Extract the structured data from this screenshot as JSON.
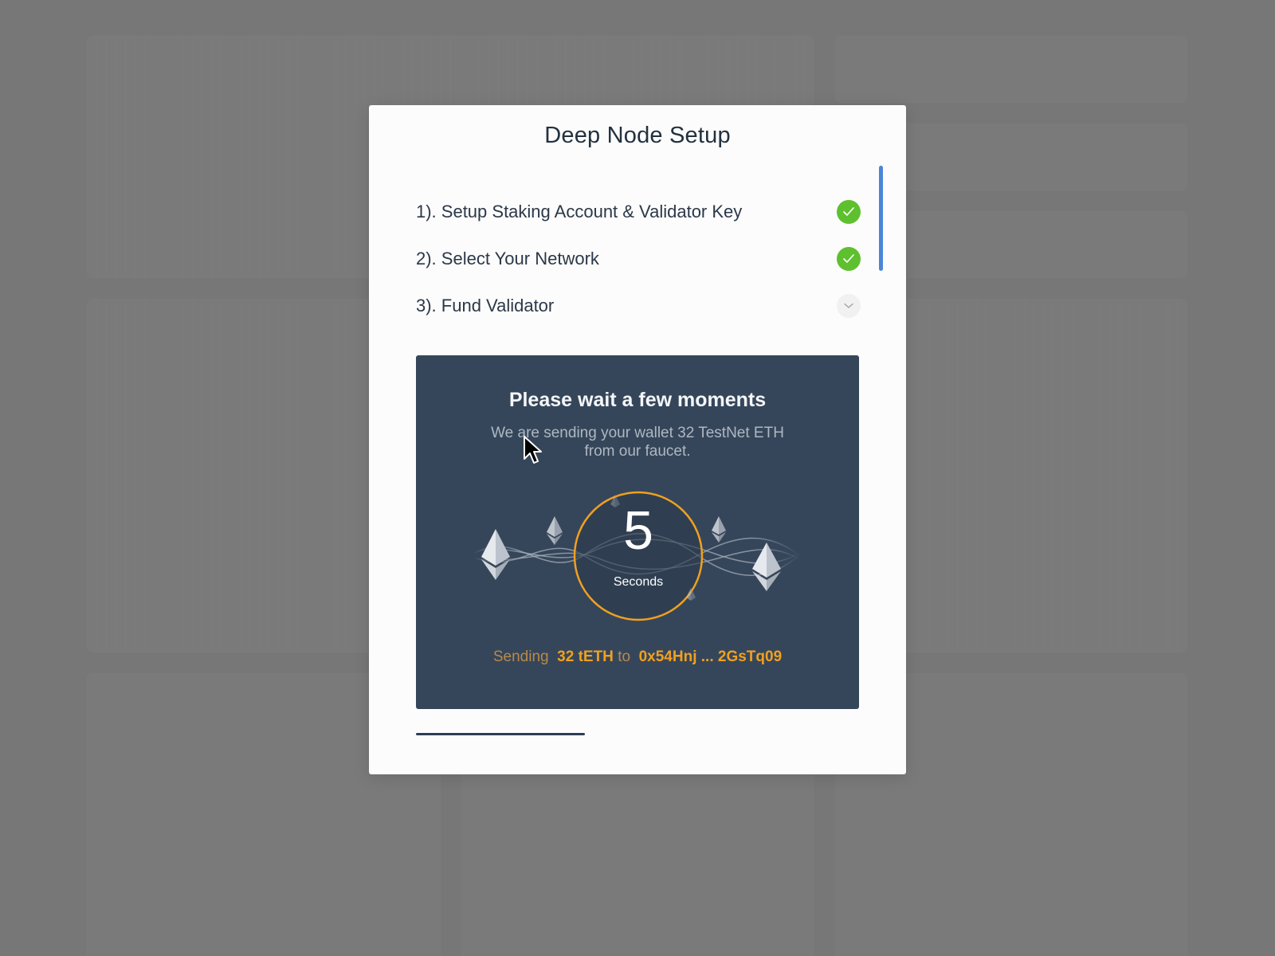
{
  "modal": {
    "title": "Deep Node Setup",
    "steps": [
      {
        "label": "1). Setup Staking Account & Validator Key",
        "status": "complete",
        "icon": "check-icon"
      },
      {
        "label": "2). Select Your Network",
        "status": "complete",
        "icon": "check-icon"
      },
      {
        "label": "3). Fund Validator",
        "status": "expanded",
        "icon": "chevron-down-icon"
      }
    ]
  },
  "faucet": {
    "title": "Please wait a few moments",
    "description": "We are sending your wallet 32 TestNet ETH from our faucet.",
    "countdown": {
      "value": "5",
      "unit": "Seconds"
    },
    "sending": {
      "prefix": "Sending",
      "amount": "32 tETH",
      "to": "to",
      "address": "0x54Hnj ... 2GsTq09"
    },
    "icons": [
      "ethereum-icon"
    ]
  },
  "colors": {
    "overlay": "#767676",
    "modal_bg": "#fcfcfc",
    "panel_bg": "#36465a",
    "accent_orange": "#f0a020",
    "success_green": "#5ec02f",
    "scroll_blue": "#4a86d8"
  }
}
